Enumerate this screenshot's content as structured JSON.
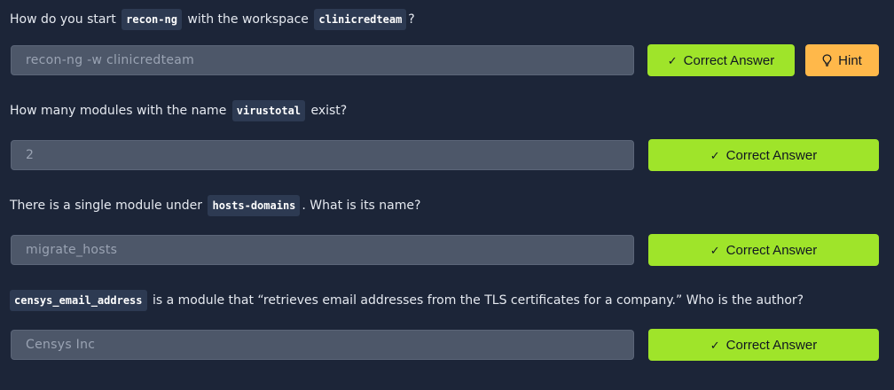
{
  "questions": [
    {
      "pre": "How do you start ",
      "code1": "recon-ng",
      "mid": " with the workspace ",
      "code2": "clinicredteam",
      "post": "?",
      "answer": "recon-ng -w clinicredteam",
      "button": "Correct Answer",
      "hint": "Hint"
    },
    {
      "pre": "How many modules with the name ",
      "code": "virustotal",
      "post": " exist?",
      "answer": "2",
      "button": "Correct Answer"
    },
    {
      "pre": "There is a single module under ",
      "code": "hosts-domains",
      "post": ". What is its name?",
      "answer": "migrate_hosts",
      "button": "Correct Answer"
    },
    {
      "code": "censys_email_address",
      "post": " is a module that “retrieves email addresses from the TLS certificates for a company.” Who is the author?",
      "answer": "Censys Inc",
      "button": "Correct Answer"
    }
  ],
  "icons": {
    "check": "check-icon",
    "hint": "lightbulb-icon"
  },
  "colors": {
    "background": "#1c2538",
    "correct_button": "#9fe42a",
    "hint_button": "#ffb84a",
    "answer_field": "#4d5769"
  }
}
